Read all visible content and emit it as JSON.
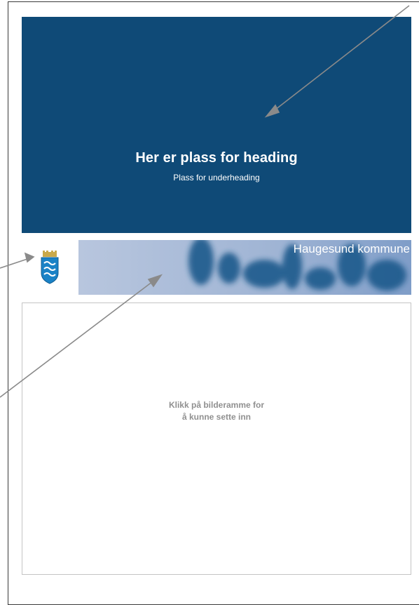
{
  "header": {
    "heading": "Her er plass for heading",
    "subheading": "Plass for underheading"
  },
  "banner": {
    "title": "Haugesund kommune"
  },
  "image_frame": {
    "line1": "Klikk på bilderamme for",
    "line2": "å kunne sette inn"
  },
  "colors": {
    "header_blue": "#0f4a77",
    "banner_light": "#a8b8d4",
    "banner_dark": "#1e5a8c",
    "arrow_gray": "#8a8a8a"
  },
  "icons": {
    "crest": "haugesund-coat-of-arms-icon"
  }
}
